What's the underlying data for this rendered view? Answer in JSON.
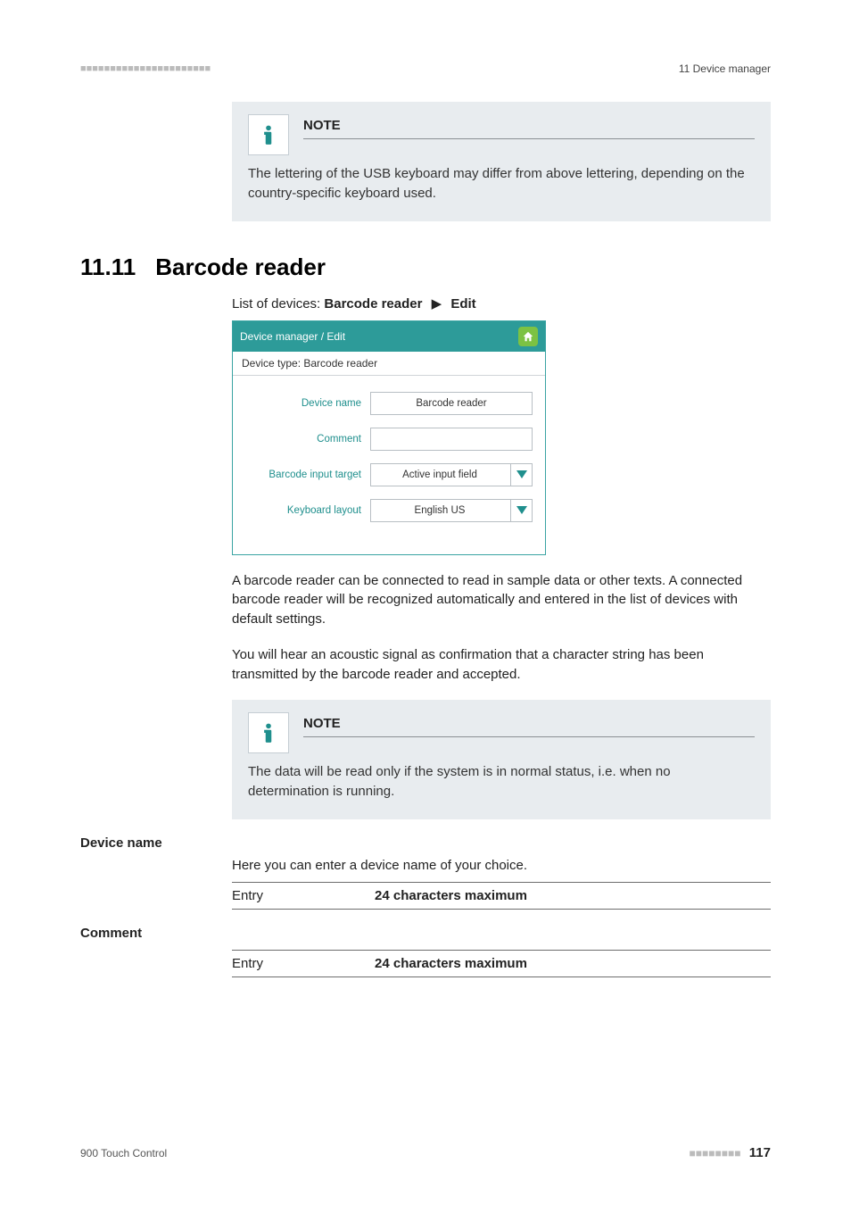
{
  "header": {
    "left_dashes": "■■■■■■■■■■■■■■■■■■■■■■",
    "right_text": "11 Device manager"
  },
  "note1": {
    "title": "NOTE",
    "body": "The lettering of the USB keyboard may differ from above lettering, depending on the country-specific keyboard used."
  },
  "section": {
    "number": "11.11",
    "title": "Barcode reader"
  },
  "breadcrumb": {
    "prefix": "List of devices: ",
    "bold1": "Barcode reader",
    "sep": "▶",
    "bold2": "Edit"
  },
  "screenshot": {
    "titlebar": "Device manager / Edit",
    "subhead": "Device type: Barcode reader",
    "rows": {
      "device_name": {
        "label": "Device name",
        "value": "Barcode reader"
      },
      "comment": {
        "label": "Comment",
        "value": ""
      },
      "target": {
        "label": "Barcode input target",
        "value": "Active input field"
      },
      "layout": {
        "label": "Keyboard layout",
        "value": "English US"
      }
    }
  },
  "para1": "A barcode reader can be connected to read in sample data or other texts. A connected barcode reader will be recognized automatically and entered in the list of devices with default settings.",
  "para2": "You will hear an acoustic signal as confirmation that a character string has been transmitted by the barcode reader and accepted.",
  "note2": {
    "title": "NOTE",
    "body": "The data will be read only if the system is in normal status, i.e. when no determination is running."
  },
  "fields": {
    "device_name": {
      "label": "Device name",
      "desc": "Here you can enter a device name of your choice.",
      "entry_label": "Entry",
      "entry_value": "24 characters maximum"
    },
    "comment": {
      "label": "Comment",
      "entry_label": "Entry",
      "entry_value": "24 characters maximum"
    }
  },
  "footer": {
    "left": "900 Touch Control",
    "dashes": "■■■■■■■■",
    "page": "117"
  }
}
